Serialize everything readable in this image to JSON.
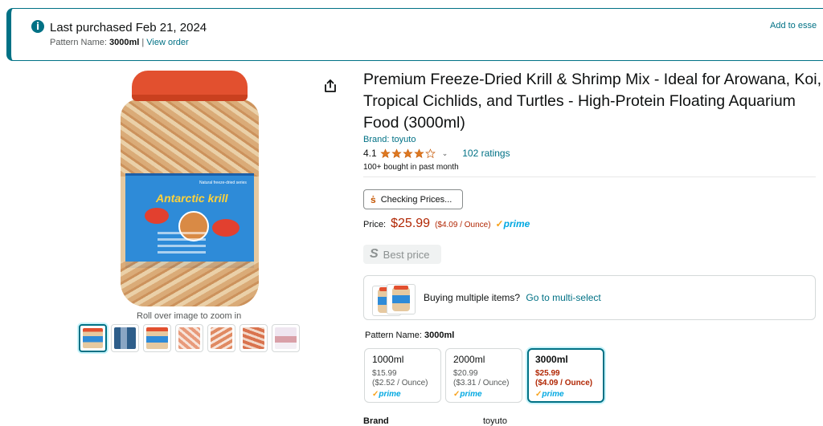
{
  "banner": {
    "title": "Last purchased Feb 21, 2024",
    "pattern_prefix": "Pattern Name:",
    "pattern_value": "3000ml",
    "separator": "|",
    "view_order": "View order",
    "right_link": "Add to esse"
  },
  "gallery": {
    "zoom_hint": "Roll over image to zoom in",
    "thumb_count": 7,
    "jar_label_title": "Antarctic krill",
    "jar_label_sub": "Natural freeze-dried series"
  },
  "product": {
    "title": "Premium Freeze-Dried Krill & Shrimp Mix - Ideal for Arowana, Koi, Tropical Cichlids, and Turtles - High-Protein Floating Aquarium Food (3000ml)",
    "brand": "Brand: toyuto",
    "rating": "4.1",
    "stars_filled": 4.1,
    "ratings_count": "102 ratings",
    "bought": "100+ bought in past month",
    "checking_prices": "Checking Prices...",
    "price_label": "Price:",
    "price": "$25.99",
    "unit_price": "($4.09 / Ounce)",
    "prime": "prime",
    "best_price": "Best price",
    "multi_text": "Buying multiple items?",
    "multi_link": "Go to multi-select"
  },
  "pattern": {
    "label": "Pattern Name:",
    "selected": "3000ml",
    "options": [
      {
        "name": "1000ml",
        "price": "$15.99",
        "unit": "($2.52 / Ounce)",
        "prime": "prime"
      },
      {
        "name": "2000ml",
        "price": "$20.99",
        "unit": "($3.31 / Ounce)",
        "prime": "prime"
      },
      {
        "name": "3000ml",
        "price": "$25.99",
        "unit": "($4.09 / Ounce)",
        "prime": "prime"
      }
    ]
  },
  "details": {
    "brand_label": "Brand",
    "brand_value": "toyuto"
  },
  "colors": {
    "link": "#007185",
    "price": "#B12704",
    "prime": "#00A8E1"
  }
}
